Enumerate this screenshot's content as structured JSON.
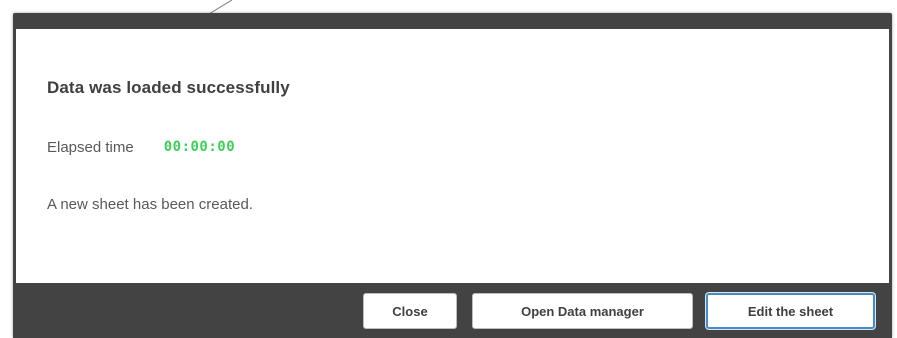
{
  "dialog": {
    "title": "Data was loaded successfully",
    "elapsed_label": "Elapsed time",
    "elapsed_value": "00:00:00",
    "message": "A new sheet has been created."
  },
  "footer": {
    "buttons": [
      {
        "label": "Close"
      },
      {
        "label": "Open Data manager"
      },
      {
        "label": "Edit the sheet",
        "focused": true
      }
    ]
  },
  "colors": {
    "footer_bg": "#434343",
    "elapsed_value": "#3fcf5a",
    "focus_border": "#4a8ac9",
    "text": "#404040"
  }
}
